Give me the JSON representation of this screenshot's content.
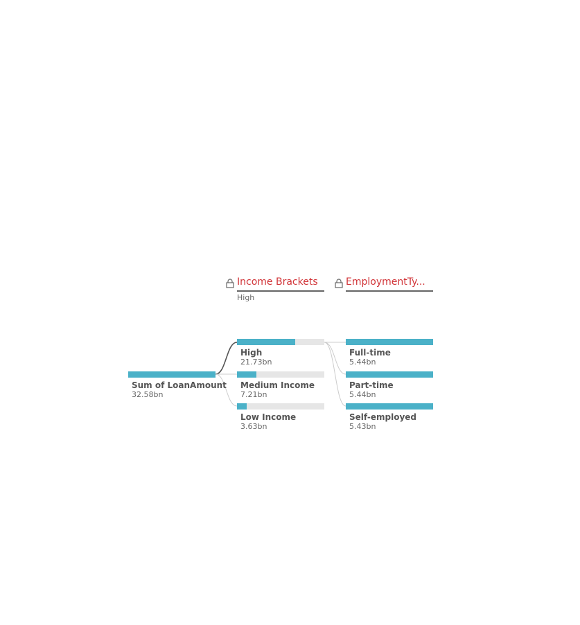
{
  "root": {
    "label": "Sum of LoanAmount",
    "value_text": "32.58bn",
    "value": 32.58
  },
  "levels": [
    {
      "title": "Income Brackets",
      "subtitle": "High",
      "icon": "lock-icon",
      "nodes": [
        {
          "label": "High",
          "value_text": "21.73bn",
          "value": 21.73
        },
        {
          "label": "Medium Income",
          "value_text": "7.21bn",
          "value": 7.21
        },
        {
          "label": "Low Income",
          "value_text": "3.63bn",
          "value": 3.63
        }
      ],
      "expanded_index": 0
    },
    {
      "title": "EmploymentTy...",
      "subtitle": "",
      "icon": "lock-icon",
      "nodes": [
        {
          "label": "Full-time",
          "value_text": "5.44bn",
          "value": 5.44
        },
        {
          "label": "Part-time",
          "value_text": "5.44bn",
          "value": 5.44
        },
        {
          "label": "Self-employed",
          "value_text": "5.43bn",
          "value": 5.43
        }
      ]
    }
  ],
  "colors": {
    "bar": "#4bb1c8",
    "track": "#e6e6e6",
    "header_text": "#d13438",
    "active_link": "#555555",
    "link": "#cccccc"
  }
}
